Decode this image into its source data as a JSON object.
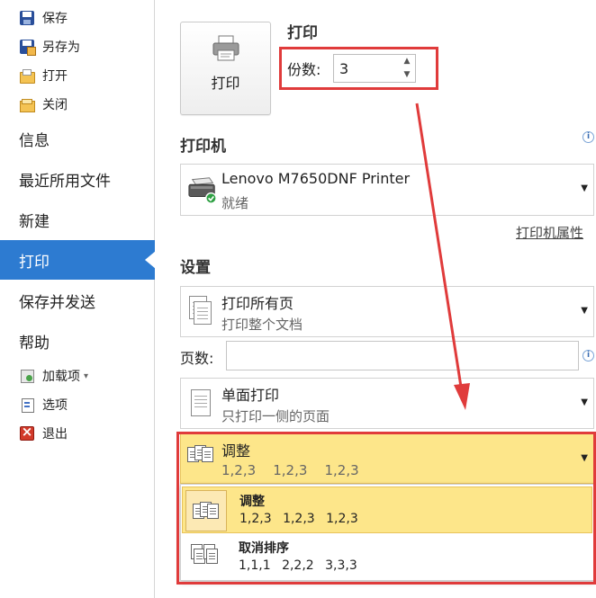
{
  "sidebar": {
    "small_top": [
      {
        "label": "保存",
        "icon": "save-icon"
      },
      {
        "label": "另存为",
        "icon": "save-as-icon"
      },
      {
        "label": "打开",
        "icon": "open-folder-icon"
      },
      {
        "label": "关闭",
        "icon": "close-folder-icon"
      }
    ],
    "big": [
      {
        "label": "信息"
      },
      {
        "label": "最近所用文件"
      },
      {
        "label": "新建"
      },
      {
        "label": "打印"
      },
      {
        "label": "保存并发送"
      },
      {
        "label": "帮助"
      }
    ],
    "small_bottom": [
      {
        "label": "加载项",
        "icon": "add-in-icon"
      },
      {
        "label": "选项",
        "icon": "options-icon"
      },
      {
        "label": "退出",
        "icon": "exit-icon"
      }
    ],
    "active_item": "打印",
    "active_color": "#2d7bd1"
  },
  "print": {
    "title": "打印",
    "button_label": "打印",
    "copies_label": "份数:",
    "copies_value": "3"
  },
  "printer": {
    "heading": "打印机",
    "name": "Lenovo M7650DNF Printer",
    "status": "就绪",
    "properties_link": "打印机属性"
  },
  "settings": {
    "heading": "设置",
    "range": {
      "title": "打印所有页",
      "subtitle": "打印整个文档"
    },
    "pages_label": "页数:",
    "pages_value": "",
    "sides": {
      "title": "单面打印",
      "subtitle": "只打印一侧的页面"
    },
    "collate": {
      "title": "调整",
      "subtitle": "1,2,3    1,2,3    1,2,3"
    },
    "collate_options": [
      {
        "title": "调整",
        "subtitle": "1,2,3 1,2,3 1,2,3"
      },
      {
        "title": "取消排序",
        "subtitle": "1,1,1 2,2,2 3,3,3"
      }
    ],
    "highlight_color": "#fde68a",
    "annotation_color": "#e03b3b"
  }
}
